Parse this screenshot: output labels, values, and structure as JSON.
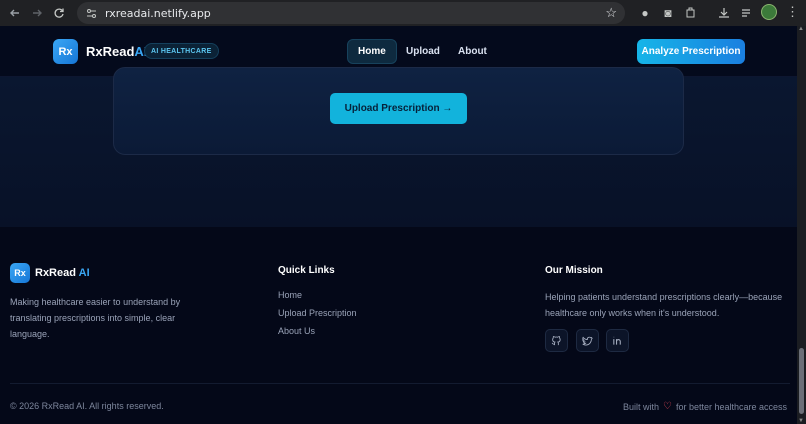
{
  "browser": {
    "url": "rxreadai.netlify.app"
  },
  "header": {
    "logo_badge": "Rx",
    "brand_main": "RxRead",
    "brand_ai": "AI",
    "pill": "AI HEALTHCARE",
    "nav": [
      {
        "label": "Home",
        "active": true
      },
      {
        "label": "Upload",
        "active": false
      },
      {
        "label": "About",
        "active": false
      }
    ],
    "cta": "Analyze Prescription"
  },
  "hero": {
    "upload_button": "Upload Prescription →"
  },
  "footer": {
    "logo_badge": "Rx",
    "brand_main": "RxRead",
    "brand_ai": "AI",
    "description": "Making healthcare easier to understand by translating prescriptions into simple, clear language.",
    "quick_links_title": "Quick Links",
    "quick_links": [
      "Home",
      "Upload Prescription",
      "About Us"
    ],
    "mission_title": "Our Mission",
    "mission_text": "Helping patients understand prescriptions clearly—because healthcare only works when it's understood.",
    "social_icons": [
      "github-icon",
      "twitter-icon",
      "linkedin-icon"
    ],
    "copyright": "© 2026 RxRead AI. All rights reserved.",
    "built_with_prefix": "Built with",
    "built_with_suffix": "for better healthcare access"
  },
  "colors": {
    "accent": "#12b3dc",
    "brand_blue": "#3aa7f5",
    "background": "#040818",
    "heart": "#ef4a5a"
  }
}
